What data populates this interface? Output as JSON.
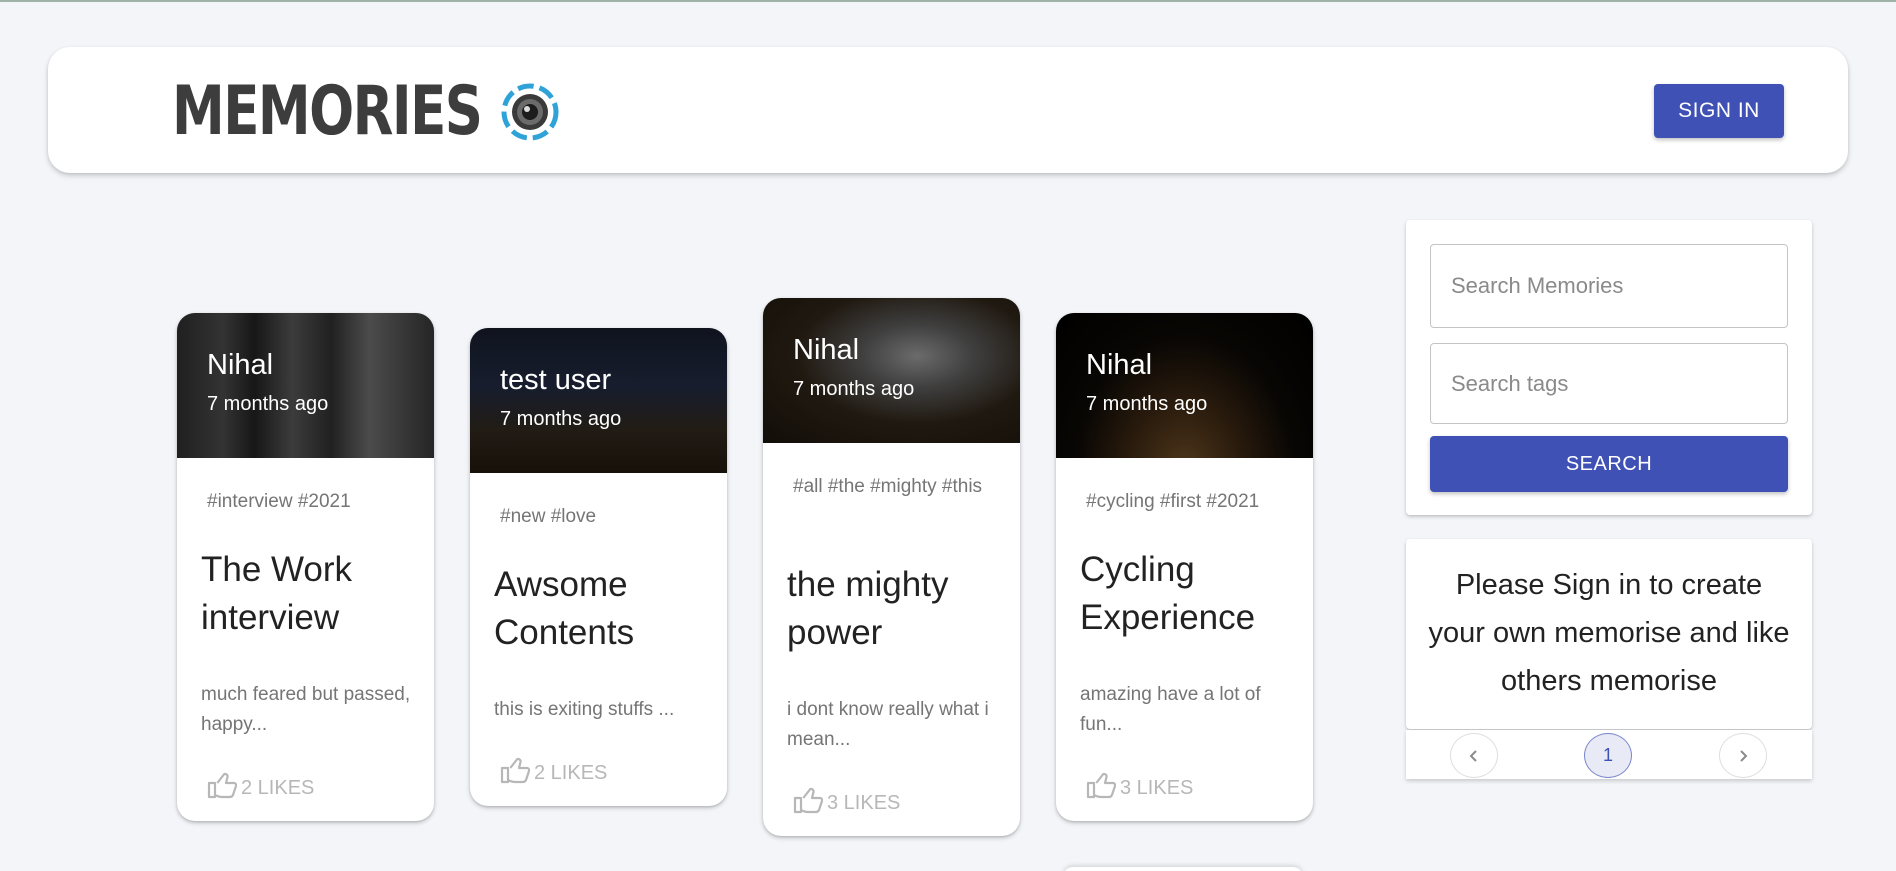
{
  "header": {
    "brand": "MEMORIES",
    "logo_icon": "camera-lens-icon",
    "signin_label": "SIGN IN",
    "accent_color": "#3f51b5"
  },
  "posts": [
    {
      "author": "Nihal",
      "time": "7 months ago",
      "tags": "#interview #2021",
      "title": "The Work interview",
      "message": "much feared but passed, happy...",
      "likes": "2 LIKES"
    },
    {
      "author": "test user",
      "time": "7 months ago",
      "tags": "#new #love",
      "title": "Awsome Contents",
      "message": "this is exiting stuffs ...",
      "likes": "2 LIKES"
    },
    {
      "author": "Nihal",
      "time": "7 months ago",
      "tags": "#all #the #mighty #this",
      "title": "the mighty power",
      "message": "i dont know really what i mean...",
      "likes": "3 LIKES"
    },
    {
      "author": "Nihal",
      "time": "7 months ago",
      "tags": "#cycling #first #2021",
      "title": "Cycling Experience",
      "message": "amazing have a lot of fun...",
      "likes": "3 LIKES"
    }
  ],
  "search": {
    "memories_placeholder": "Search Memories",
    "tags_placeholder": "Search tags",
    "button_label": "SEARCH"
  },
  "info": {
    "message": "Please Sign in to create your own memorise and like others memorise"
  },
  "pagination": {
    "prev_icon": "chevron-left-icon",
    "current_page": "1",
    "next_icon": "chevron-right-icon"
  }
}
